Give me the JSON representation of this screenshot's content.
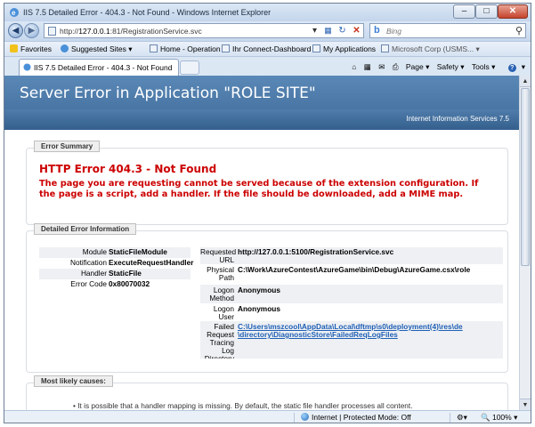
{
  "window": {
    "title": "IIS 7.5 Detailed Error - 404.3 - Not Found - Windows Internet Explorer",
    "minimize": "–",
    "maximize": "□",
    "close": "✕"
  },
  "nav": {
    "address_prefix": "http://",
    "address_host": "127.0.0.1",
    "address_rest": ":81/RegistrationService.svc",
    "search_placeholder": "Bing"
  },
  "favorites_bar": {
    "items": [
      {
        "label": "Favorites",
        "icon": "star-icon"
      },
      {
        "label": "Suggested Sites ▾",
        "icon": "ie-icon"
      },
      {
        "label": "Home - Operation",
        "icon": "page-icon"
      },
      {
        "label": "Ihr Connect-Dashboard",
        "icon": "page-icon"
      },
      {
        "label": "My Applications",
        "icon": "page-icon"
      },
      {
        "label": "Microsoft Corp (USMS... ▾",
        "icon": "page-icon"
      }
    ]
  },
  "tabs": {
    "active_label": "IIS 7.5 Detailed Error - 404.3 - Not Found"
  },
  "command_bar": {
    "page": "Page ▾",
    "safety": "Safety ▾",
    "tools": "Tools ▾",
    "help": "▾"
  },
  "page": {
    "banner_title": "Server Error in Application \"ROLE SITE\"",
    "iis_label": "Internet Information Services 7.5",
    "summary": {
      "tab": "Error Summary",
      "heading": "HTTP Error 404.3 - Not Found",
      "message": "The page you are requesting cannot be served because of the extension configuration. If the page is a script, add a handler. If the file should be downloaded, add a MIME map."
    },
    "detail": {
      "tab": "Detailed Error Information",
      "left": [
        {
          "key": "Module",
          "value": "StaticFileModule"
        },
        {
          "key": "Notification",
          "value": "ExecuteRequestHandler"
        },
        {
          "key": "Handler",
          "value": "StaticFile"
        },
        {
          "key": "Error Code",
          "value": "0x80070032"
        }
      ],
      "right": [
        {
          "key": "Requested URL",
          "value": "http://127.0.0.1:5100/RegistrationService.svc"
        },
        {
          "key": "Physical Path",
          "value": "C:\\Work\\AzureContest\\AzureGame\\bin\\Debug\\AzureGame.csx\\role"
        },
        {
          "key": "Logon Method",
          "value": "Anonymous"
        },
        {
          "key": "Logon User",
          "value": "Anonymous"
        },
        {
          "key": "Failed Request Tracing Log Directory",
          "value": "C:\\Users\\mszcool\\AppData\\Local\\dftmp\\s0\\deployment(4)\\res\\de",
          "value2": "\\directory\\DiagnosticStore\\FailedReqLogFiles"
        }
      ]
    },
    "causes": {
      "tab": "Most likely causes:",
      "text": "•   It is possible that a handler mapping is missing. By default, the static file handler processes all content."
    }
  },
  "status": {
    "zone": "Internet | Protected Mode: Off",
    "zoom": "100%"
  }
}
